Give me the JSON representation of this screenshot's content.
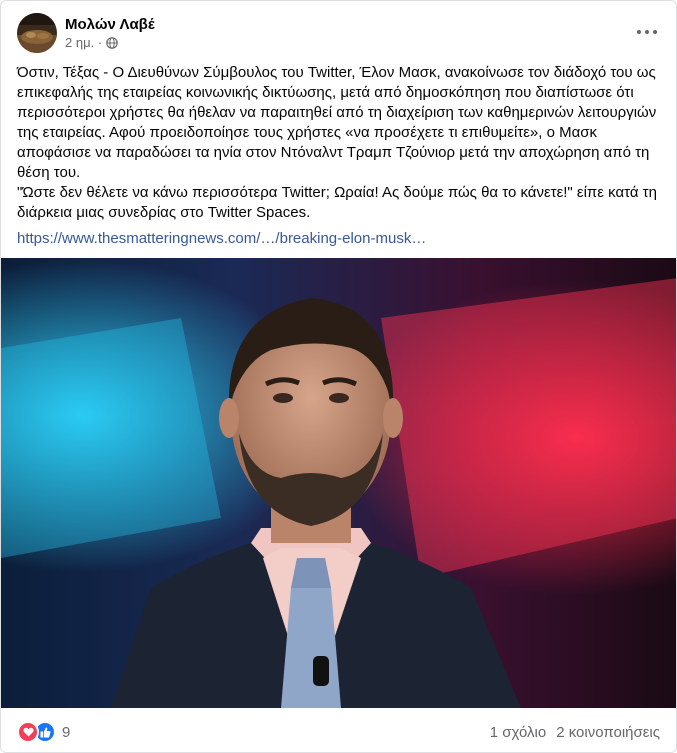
{
  "post": {
    "author": "Μολών Λαβέ",
    "time": "2 ημ. ·",
    "paragraph1": "Όστιν, Τέξας - Ο Διευθύνων Σύμβουλος του Twitter, Έλον Μασκ, ανακοίνωσε τον διάδοχό του ως επικεφαλής της εταιρείας κοινωνικής δικτύωσης, μετά από δημοσκόπηση που διαπίστωσε ότι περισσότεροι χρήστες θα ήθελαν να παραιτηθεί από τη διαχείριση των καθημερινών λειτουργιών της εταιρείας. Αφού προειδοποίησε τους χρήστες «να προσέχετε τι επιθυμείτε», ο Μασκ αποφάσισε να παραδώσει τα ηνία στον Ντόναλντ Τραμπ Τζούνιορ μετά την αποχώρηση από τη θέση του.",
    "paragraph2": "\"Ώστε δεν θέλετε να κάνω περισσότερα Twitter; Ωραία! Ας δούμε πώς θα το κάνετε!\" είπε κατά τη διάρκεια μιας συνεδρίας στο Twitter Spaces.",
    "link": "https://www.thesmatteringnews.com/…/breaking-elon-musk…"
  },
  "icons": {
    "audience": "globe-icon",
    "menu": "more-options-icon",
    "reaction_1": "heart-reaction-icon",
    "reaction_2": "like-reaction-icon"
  },
  "footer": {
    "reactions_count": "9",
    "comments": "1 σχόλιο",
    "shares": "2 κοινοποιήσεις"
  },
  "colors": {
    "link": "#385898",
    "secondary_text": "#65676b",
    "like_blue": "#1877f2",
    "heart_red": "#f33e58"
  }
}
